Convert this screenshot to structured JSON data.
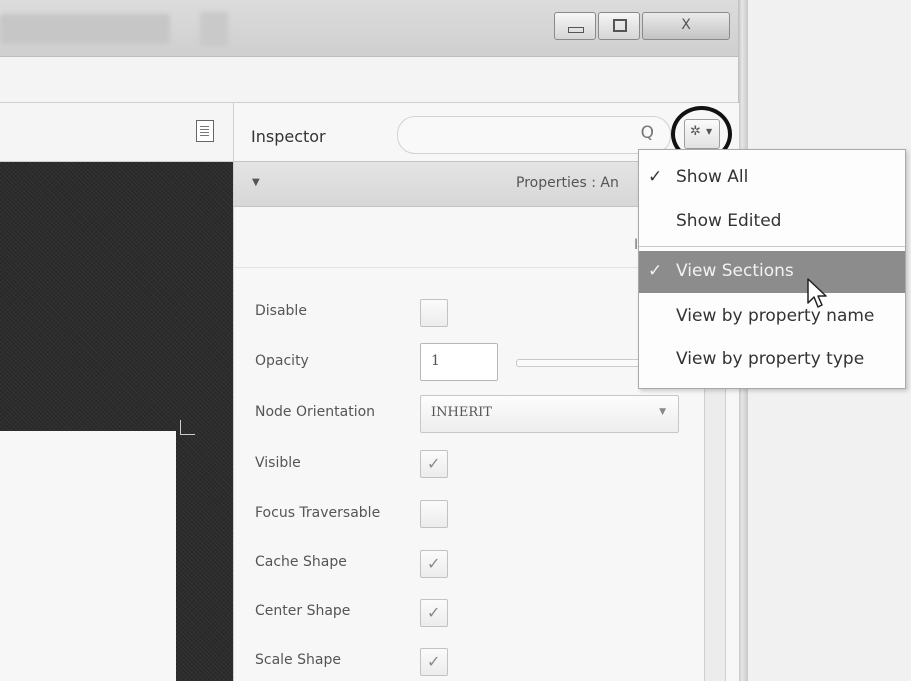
{
  "window": {
    "controls": {
      "minimize_icon": "minimize-icon",
      "maximize_icon": "maximize-icon",
      "close_glyph": "X"
    }
  },
  "inspector": {
    "title": "Inspector",
    "search": {
      "value": "",
      "placeholder": ""
    },
    "search_icon": "Q",
    "section_header": {
      "label": "Properties : An"
    },
    "subheader_fragment": "I",
    "properties": {
      "disable": {
        "label": "Disable",
        "checked": false
      },
      "opacity": {
        "label": "Opacity",
        "value": "1"
      },
      "node_orientation": {
        "label": "Node Orientation",
        "value": "INHERIT"
      },
      "visible": {
        "label": "Visible",
        "checked": true
      },
      "focus_traversable": {
        "label": "Focus Traversable",
        "checked": false
      },
      "cache_shape": {
        "label": "Cache Shape",
        "checked": true
      },
      "center_shape": {
        "label": "Center Shape",
        "checked": true
      },
      "scale_shape": {
        "label": "Scale Shape",
        "checked": true
      }
    }
  },
  "settings_menu": {
    "items": [
      {
        "label": "Show All",
        "checked": true,
        "highlighted": false
      },
      {
        "label": "Show Edited",
        "checked": false,
        "highlighted": false
      },
      {
        "label": "View Sections",
        "checked": true,
        "highlighted": true
      },
      {
        "label": "View by property name",
        "checked": false,
        "highlighted": false
      },
      {
        "label": "View by property type",
        "checked": false,
        "highlighted": false
      }
    ],
    "check_glyph": "✓"
  },
  "colors": {
    "menu_highlight": "#8c8c8c",
    "canvas_dark": "#2c2c2c",
    "annotation_circle": "#111111"
  }
}
